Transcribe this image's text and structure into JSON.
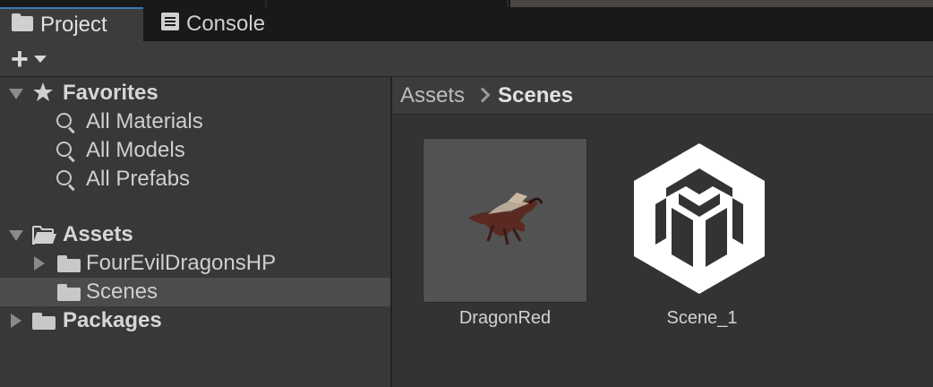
{
  "tabs": {
    "project_label": "Project",
    "console_label": "Console"
  },
  "toolbar": {
    "add_label": "+"
  },
  "tree": {
    "favorites": {
      "label": "Favorites",
      "items": [
        "All Materials",
        "All Models",
        "All Prefabs"
      ]
    },
    "assets": {
      "label": "Assets",
      "children": [
        "FourEvilDragonsHP",
        "Scenes"
      ]
    },
    "packages": {
      "label": "Packages"
    }
  },
  "breadcrumb": {
    "root": "Assets",
    "current": "Scenes"
  },
  "assets_grid": [
    {
      "name": "DragonRed",
      "icon": "dragon-thumbnail"
    },
    {
      "name": "Scene_1",
      "icon": "unity-scene-icon"
    }
  ],
  "colors": {
    "tab_accent": "#3a79bb",
    "selected_row": "#4c4c4c",
    "panel_bg": "#383838"
  }
}
